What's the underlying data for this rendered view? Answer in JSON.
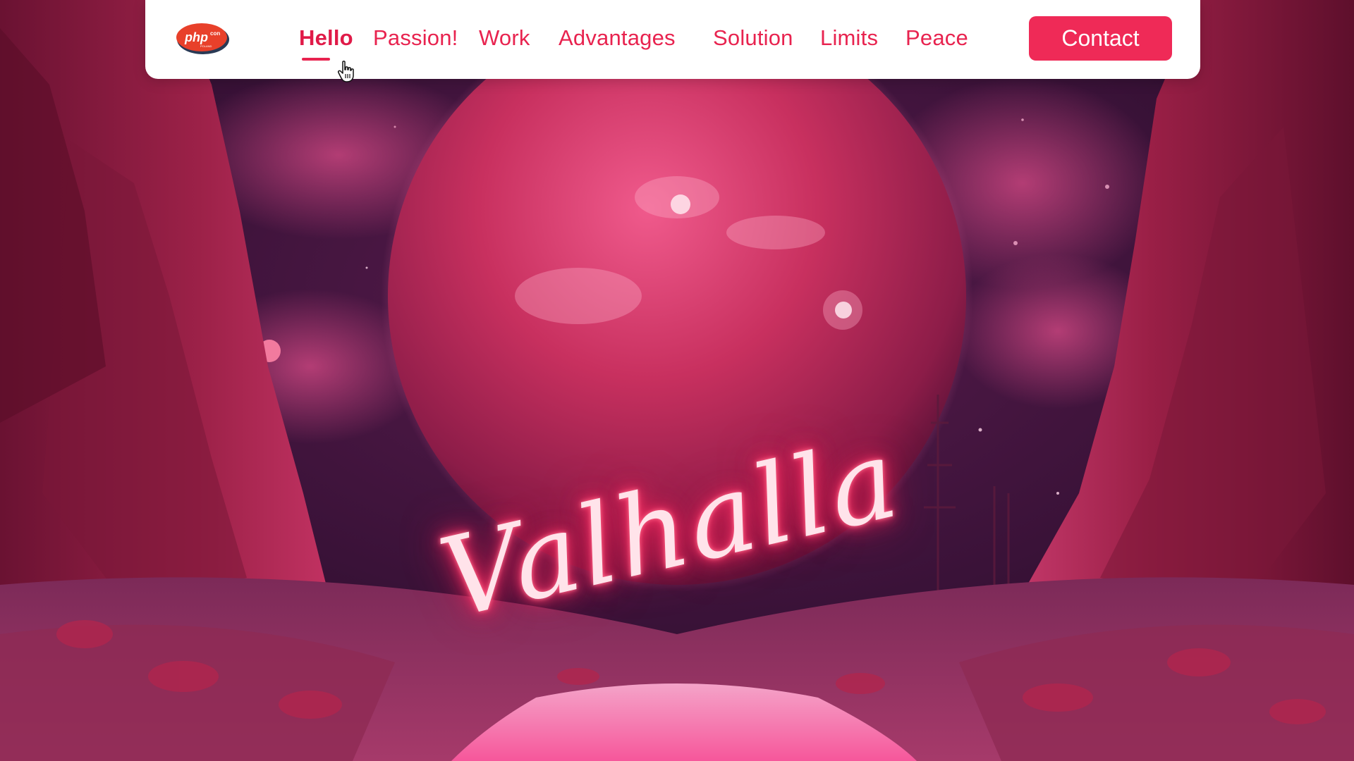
{
  "brand": {
    "logo_text": "php",
    "logo_superscript": "con",
    "logo_tagline": "POLAND"
  },
  "nav": {
    "items": [
      {
        "label": "Hello",
        "active": true
      },
      {
        "label": "Passion!",
        "active": false
      },
      {
        "label": "Work",
        "active": false
      },
      {
        "label": "Advantages",
        "active": false
      },
      {
        "label": "Solution",
        "active": false
      },
      {
        "label": "Limits",
        "active": false
      },
      {
        "label": "Peace",
        "active": false
      }
    ],
    "contact_label": "Contact"
  },
  "hero": {
    "sign_text": "Valhalla"
  },
  "colors": {
    "accent": "#ef2a57",
    "nav_text": "#e8234f",
    "navbar_bg": "#ffffff",
    "sky": "#3a1238",
    "planet": "#c0305f",
    "rocks": "#8a1a3e",
    "water": "#ff8fc0"
  },
  "icons": {
    "cursor": "hand-pointer-icon",
    "logo": "phpcon-logo"
  }
}
